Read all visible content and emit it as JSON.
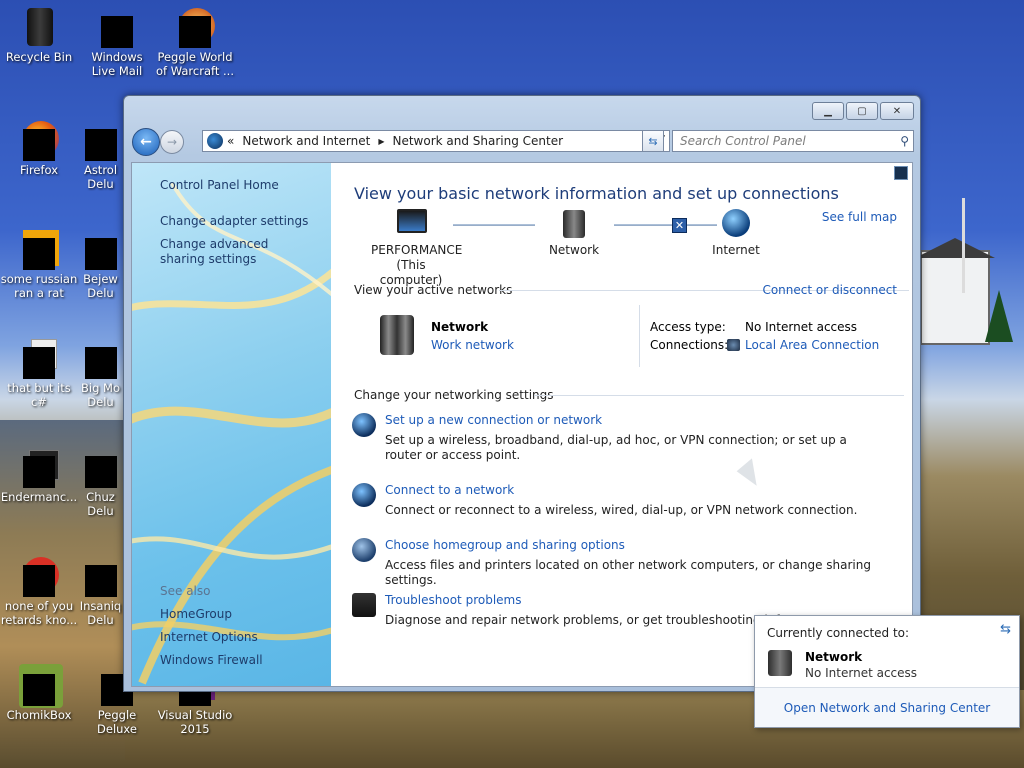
{
  "desktop": {
    "icons": [
      {
        "label": "Recycle Bin"
      },
      {
        "label": "Windows Live Mail"
      },
      {
        "label": "Peggle World of Warcraft ..."
      },
      {
        "label": "Firefox"
      },
      {
        "label": "Astrol Delu"
      },
      {
        "label": "some russian ran a rat"
      },
      {
        "label": "Bejew Delu"
      },
      {
        "label": "that but its c#"
      },
      {
        "label": "Big Mo Delu"
      },
      {
        "label": "Endermanc..."
      },
      {
        "label": "Chuz Delu"
      },
      {
        "label": "none of you retards kno..."
      },
      {
        "label": "Insaniq Delu"
      },
      {
        "label": "ChomikBox"
      },
      {
        "label": "Peggle Deluxe"
      },
      {
        "label": "Visual Studio 2015"
      }
    ]
  },
  "window": {
    "breadcrumb": {
      "overflow": "«",
      "items": [
        "Network and Internet",
        "Network and Sharing Center"
      ]
    },
    "search": {
      "placeholder": "Search Control Panel"
    },
    "sidebar": {
      "home": "Control Panel Home",
      "adapter": "Change adapter settings",
      "advanced": "Change advanced sharing settings",
      "see_also": "See also",
      "homegroup": "HomeGroup",
      "internet_options": "Internet Options",
      "firewall": "Windows Firewall"
    },
    "main": {
      "heading": "View your basic network information and set up connections",
      "see_full_map": "See full map",
      "map": {
        "computer": "PERFORMANCE",
        "computer_sub": "(This computer)",
        "network": "Network",
        "internet": "Internet"
      },
      "active_networks": {
        "title": "View your active networks",
        "connect_link": "Connect or disconnect",
        "network_name": "Network",
        "network_type": "Work network",
        "access_label": "Access type:",
        "access_value": "No Internet access",
        "connections_label": "Connections:",
        "connections_value": "Local Area Connection"
      },
      "settings": {
        "title": "Change your networking settings",
        "items": [
          {
            "title": "Set up a new connection or network",
            "desc": "Set up a wireless, broadband, dial-up, ad hoc, or VPN connection; or set up a router or access point."
          },
          {
            "title": "Connect to a network",
            "desc": "Connect or reconnect to a wireless, wired, dial-up, or VPN network connection."
          },
          {
            "title": "Choose homegroup and sharing options",
            "desc": "Access files and printers located on other network computers, or change sharing settings."
          },
          {
            "title": "Troubleshoot problems",
            "desc": "Diagnose and repair network problems, or get troubleshooting inf"
          }
        ]
      }
    }
  },
  "popup": {
    "header": "Currently connected to:",
    "network": "Network",
    "status": "No Internet access",
    "footer_link": "Open Network and Sharing Center"
  }
}
